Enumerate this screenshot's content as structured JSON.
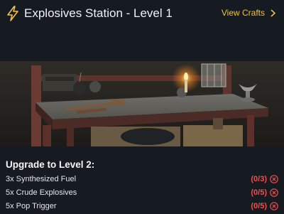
{
  "header": {
    "title": "Explosives Station - Level 1",
    "view_crafts": "View Crafts",
    "accent": "#f2c14a"
  },
  "scene": {
    "description_icon": "workbench-image"
  },
  "upgrade": {
    "title": "Upgrade to Level 2:",
    "missing_color": "#ef4f4f",
    "requirements": [
      {
        "name": "3x Synthesized Fuel",
        "count": "(0/3)"
      },
      {
        "name": "5x Crude Explosives",
        "count": "(0/5)"
      },
      {
        "name": "5x Pop Trigger",
        "count": "(0/5)"
      }
    ]
  }
}
